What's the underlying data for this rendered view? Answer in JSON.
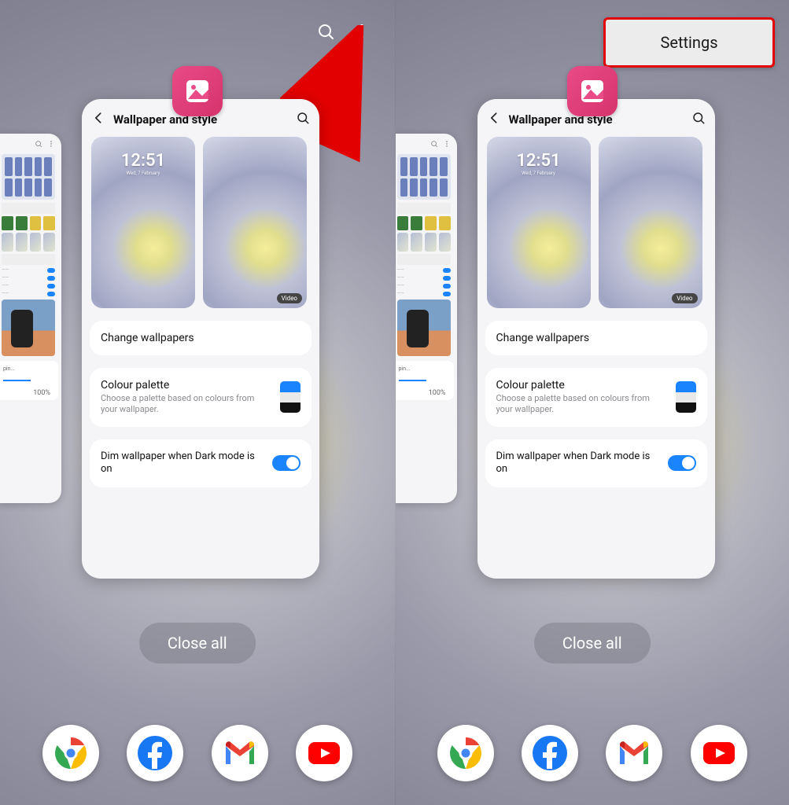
{
  "colors": {
    "accent": "#1a84ff",
    "pink": "#e94b86",
    "red_highlight": "#e30000"
  },
  "topbar": {
    "search_icon": "search",
    "more_icon": "more-vertical"
  },
  "popup": {
    "settings_label": "Settings"
  },
  "app_icon": {
    "name": "gallery"
  },
  "card": {
    "title": "Wallpaper and style",
    "lock_preview": {
      "time": "12:51",
      "date": "Wed, 7 February"
    },
    "home_preview": {
      "badge": "Video"
    },
    "change_wallpapers_label": "Change wallpapers",
    "colour_palette": {
      "title": "Colour palette",
      "subtitle": "Choose a palette based on colours from your wallpaper.",
      "swatch": [
        "#1a84ff",
        "#e9e9e9",
        "#111111"
      ]
    },
    "dim_toggle": {
      "label": "Dim wallpaper when Dark mode is on",
      "on": true
    }
  },
  "peek": {
    "label": "pin...",
    "progress_pct": "100%"
  },
  "close_all_label": "Close all",
  "dock": [
    "chrome",
    "facebook",
    "gmail",
    "youtube"
  ]
}
